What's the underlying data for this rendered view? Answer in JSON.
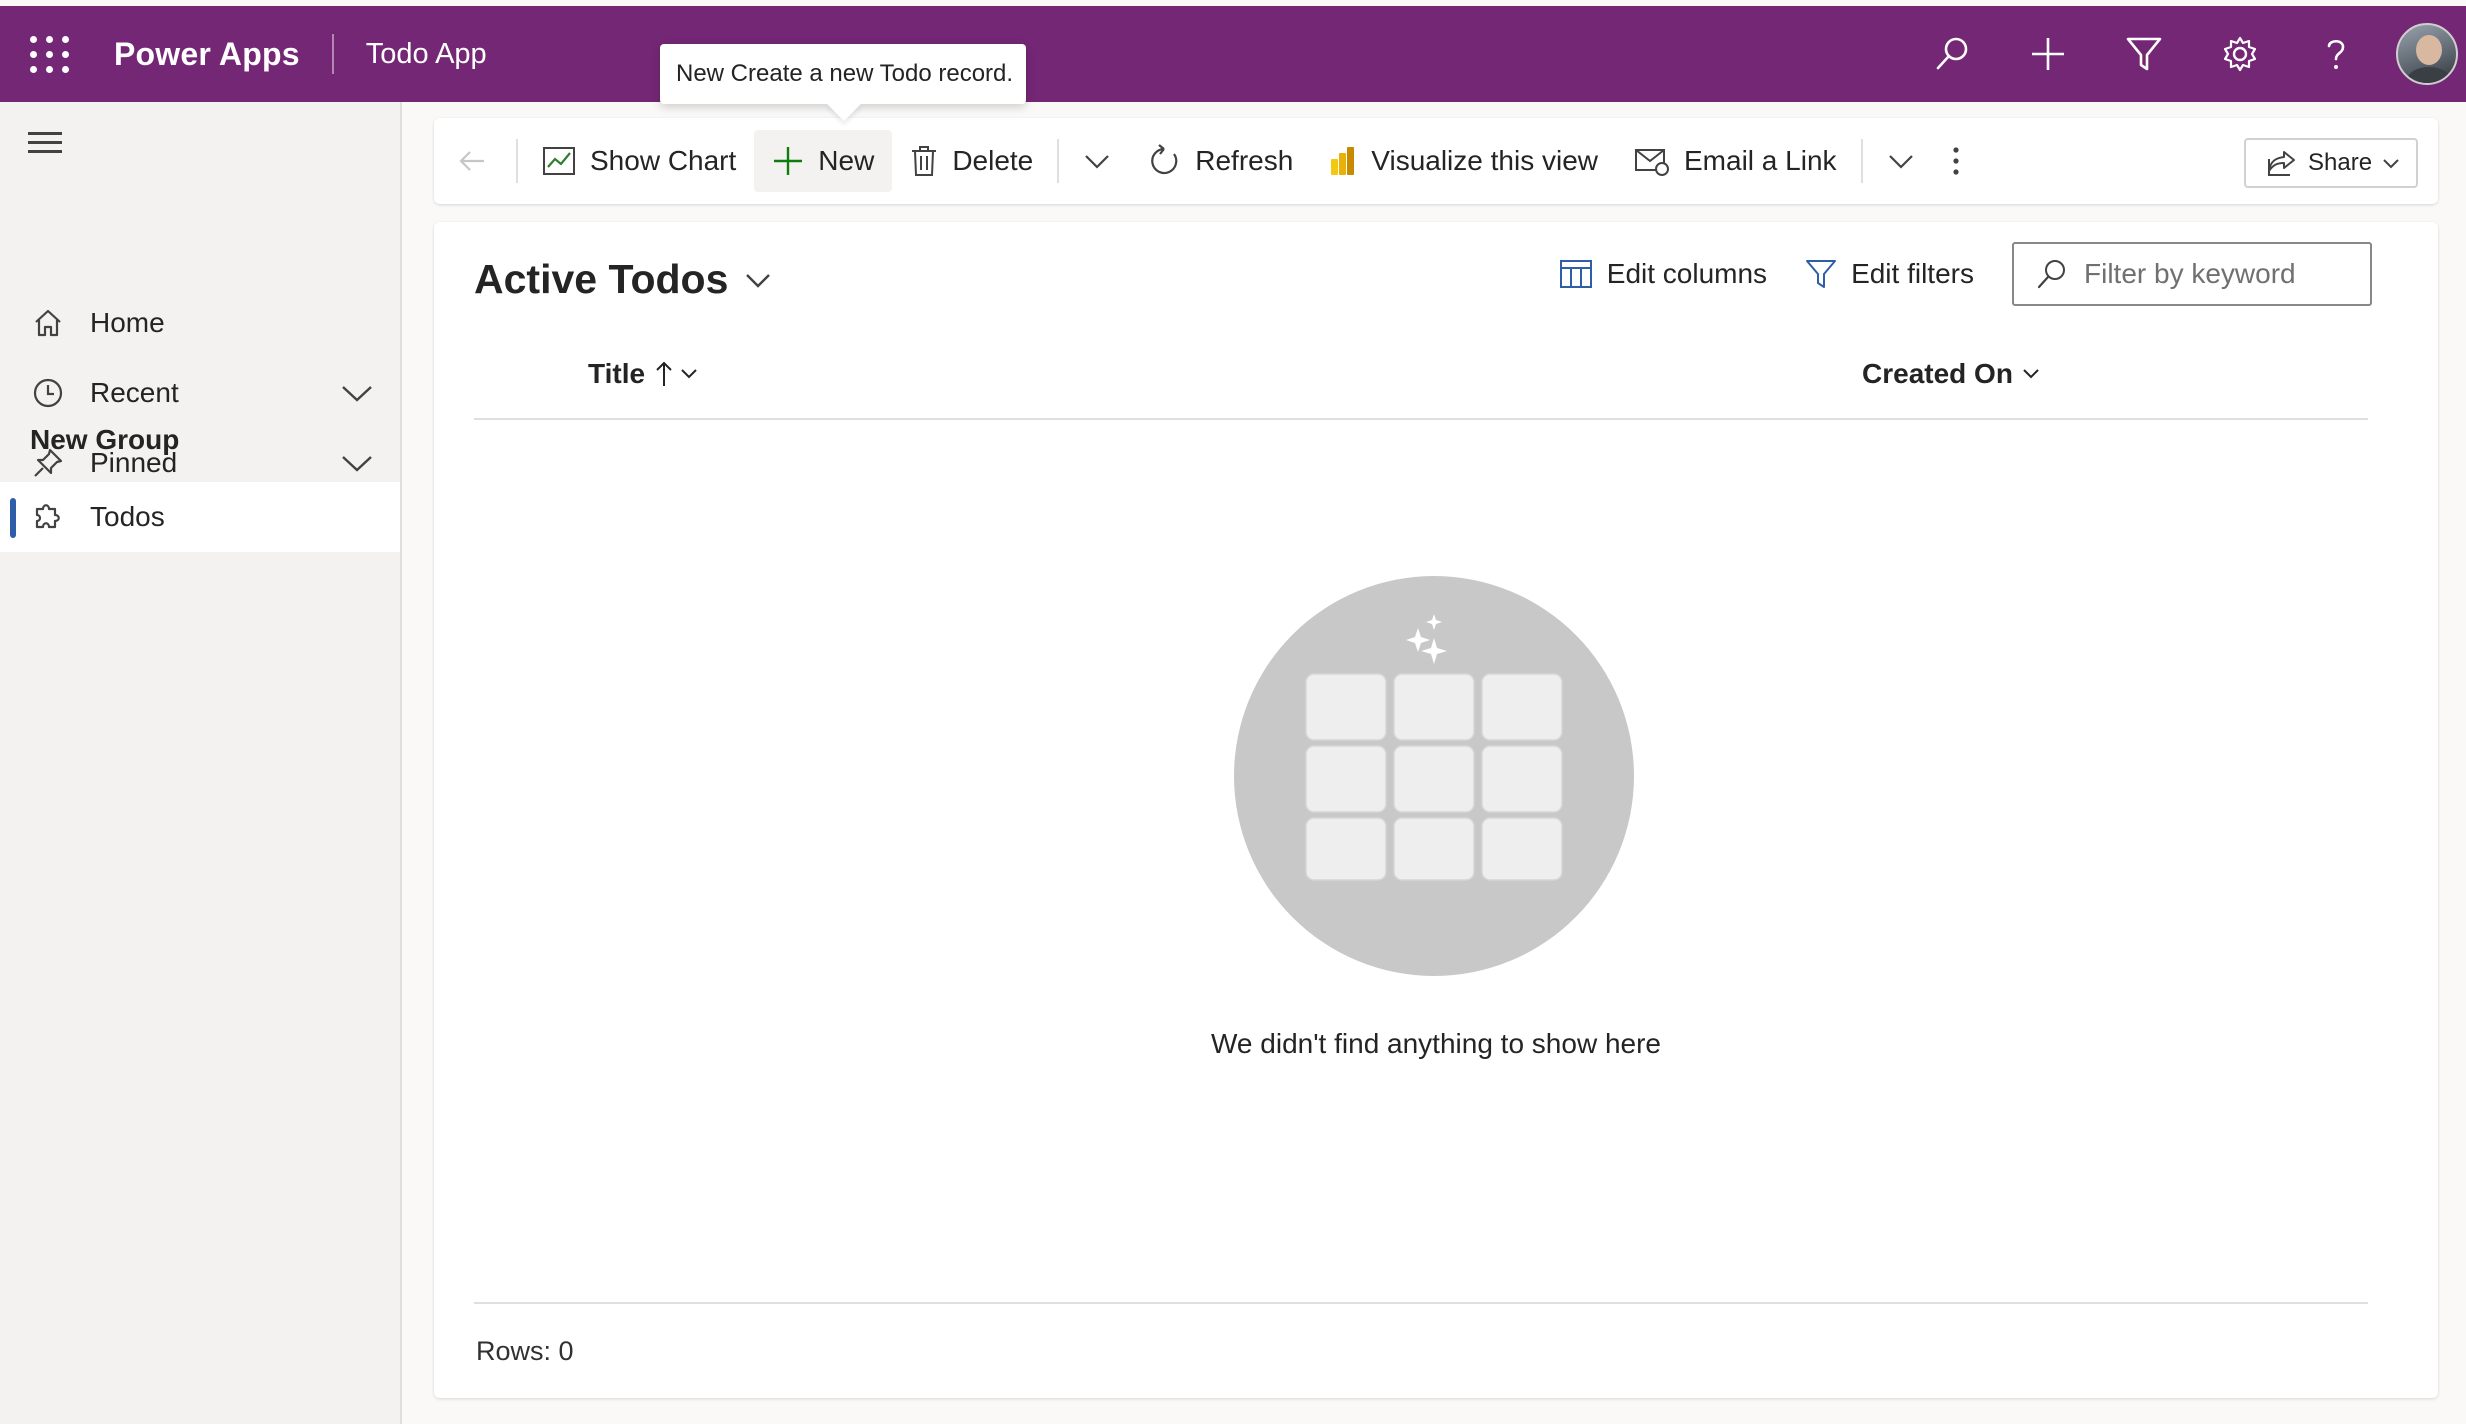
{
  "header": {
    "app_name": "Power Apps",
    "environment": "Todo App",
    "icons": [
      "search-icon",
      "plus-icon",
      "filter-icon",
      "gear-icon",
      "help-icon",
      "avatar"
    ]
  },
  "tooltip": {
    "text": "New Create a new Todo record."
  },
  "sidebar": {
    "items": [
      {
        "label": "Home",
        "icon": "home-icon"
      },
      {
        "label": "Recent",
        "icon": "clock-icon"
      },
      {
        "label": "Pinned",
        "icon": "pin-icon"
      }
    ],
    "group_label": "New Group",
    "entities": [
      {
        "label": "Todos",
        "icon": "puzzle-icon",
        "active": true
      }
    ]
  },
  "toolbar": {
    "show_chart": "Show Chart",
    "new": "New",
    "delete": "Delete",
    "refresh": "Refresh",
    "visualize": "Visualize this view",
    "email_link": "Email a Link",
    "share": "Share"
  },
  "view": {
    "title": "Active Todos",
    "edit_columns": "Edit columns",
    "edit_filters": "Edit filters",
    "search_placeholder": "Filter by keyword",
    "columns": [
      {
        "label": "Title",
        "sort": "ascending"
      },
      {
        "label": "Created On"
      }
    ],
    "empty_message": "We didn't find anything to show here",
    "row_count": "Rows: 0"
  },
  "colors": {
    "header_bg": "#742774",
    "accent": "#2f5ea8",
    "new_icon": "#107c10"
  }
}
